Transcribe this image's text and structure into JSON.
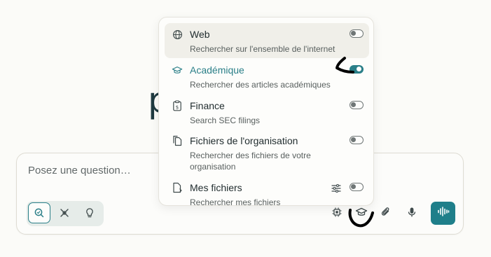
{
  "background": {
    "title_fragment": "p"
  },
  "composer": {
    "placeholder": "Posez une question…",
    "modes": [
      {
        "icon": "search-mode-icon",
        "active": true
      },
      {
        "icon": "research-mode-icon",
        "active": false
      },
      {
        "icon": "lightbulb-mode-icon",
        "active": false
      }
    ],
    "tools": [
      "chip-icon",
      "graduation-cap-icon",
      "paperclip-icon",
      "microphone-icon"
    ],
    "voice_icon": "voice-wave-icon"
  },
  "sources_menu": {
    "items": [
      {
        "icon": "globe-icon",
        "title": "Web",
        "description": "Rechercher sur l'ensemble de l'internet",
        "enabled": false
      },
      {
        "icon": "graduation-cap-icon",
        "title": "Académique",
        "description": "Rechercher des articles académiques",
        "enabled": true
      },
      {
        "icon": "finance-clipboard-icon",
        "title": "Finance",
        "description": "Search SEC filings",
        "enabled": false
      },
      {
        "icon": "files-icon",
        "title": "Fichiers de l'organisation",
        "description": "Rechercher des fichiers de votre organisation",
        "enabled": false
      },
      {
        "icon": "file-icon",
        "title": "Mes fichiers",
        "description": "Rechercher mes fichiers",
        "enabled": false
      }
    ]
  },
  "colors": {
    "accent": "#1f7f8a",
    "active_text": "#2a7f88",
    "background": "#fbfbf8"
  }
}
